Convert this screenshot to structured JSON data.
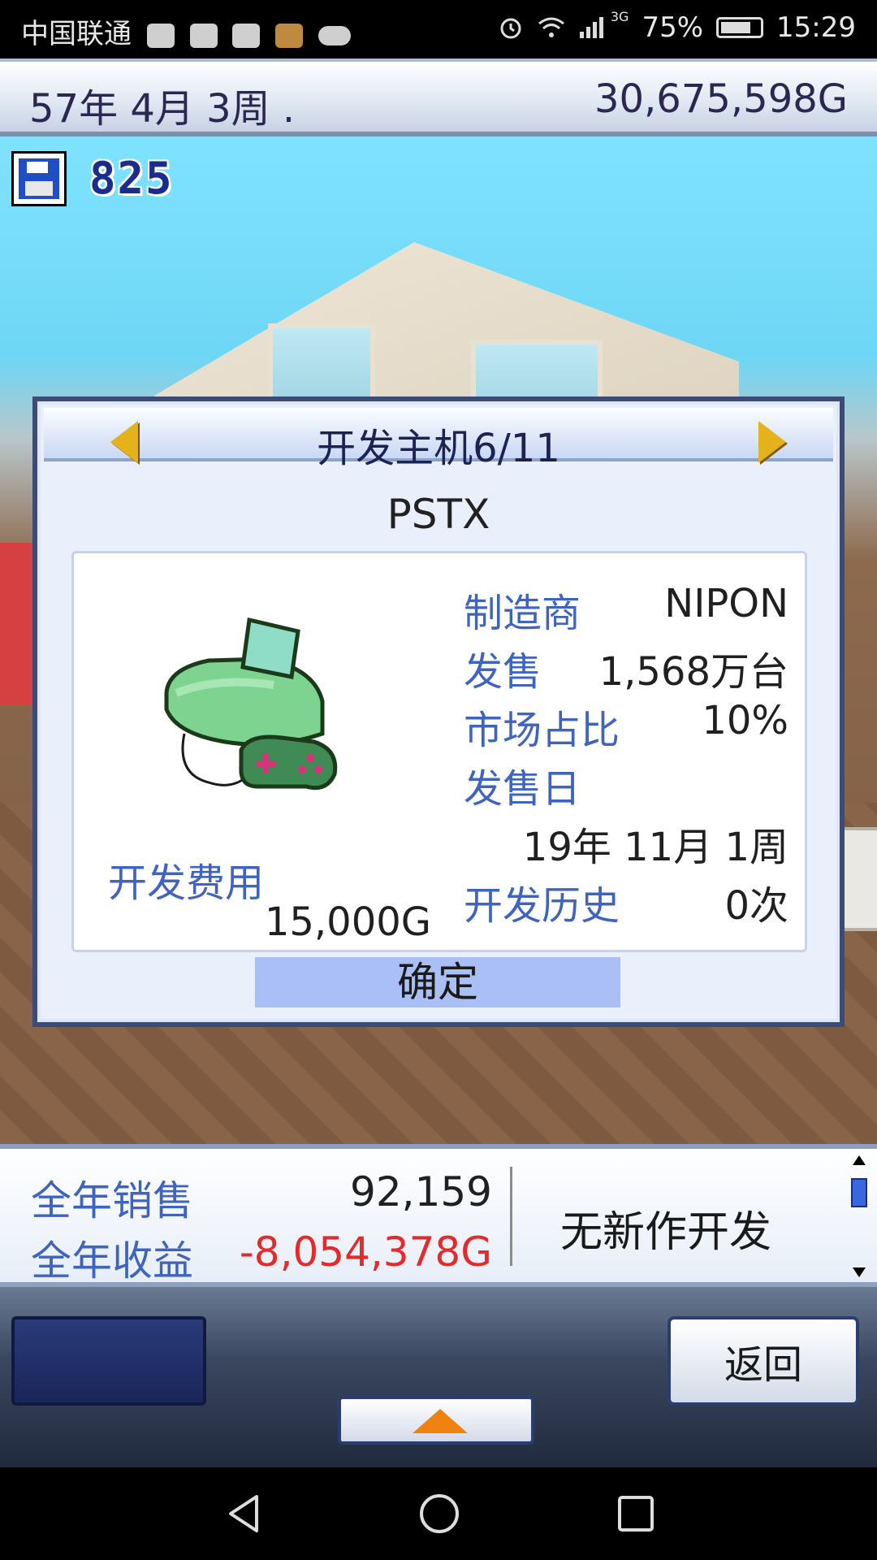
{
  "status_bar": {
    "carrier": "中国联通",
    "battery": "75%",
    "time": "15:29",
    "network": "3G",
    "icons": [
      "app-icon",
      "wechat-icon",
      "hand-icon",
      "box-app-icon",
      "cloud-icon",
      "alarm-icon",
      "wifi-icon",
      "signal-icon",
      "battery-icon"
    ]
  },
  "top_bar": {
    "date": "57年 4月 3周 .",
    "money": "30,675,598G"
  },
  "save": {
    "count": "825"
  },
  "dialog": {
    "title": "开发主机6/11",
    "console_name": "PSTX",
    "specs": {
      "maker_label": "制造商",
      "maker": "NIPON",
      "sales_label": "发售",
      "sales": "1,568万台",
      "share_label": "市场占比",
      "share": "10%",
      "release_label": "发售日",
      "release": "19年 11月 1周",
      "history_label": "开发历史",
      "history": "0次"
    },
    "dev_cost_label": "开发费用",
    "dev_cost": "15,000G",
    "confirm_label": "确定",
    "accent": "#e4b21a"
  },
  "stats": {
    "annual_sales_label": "全年销售",
    "annual_sales": "92,159",
    "annual_profit_label": "全年收益",
    "annual_profit": "-8,054,378G",
    "no_dev": "无新作开发",
    "negative_color": "#e52a2a"
  },
  "controls": {
    "back_label": "返回"
  }
}
